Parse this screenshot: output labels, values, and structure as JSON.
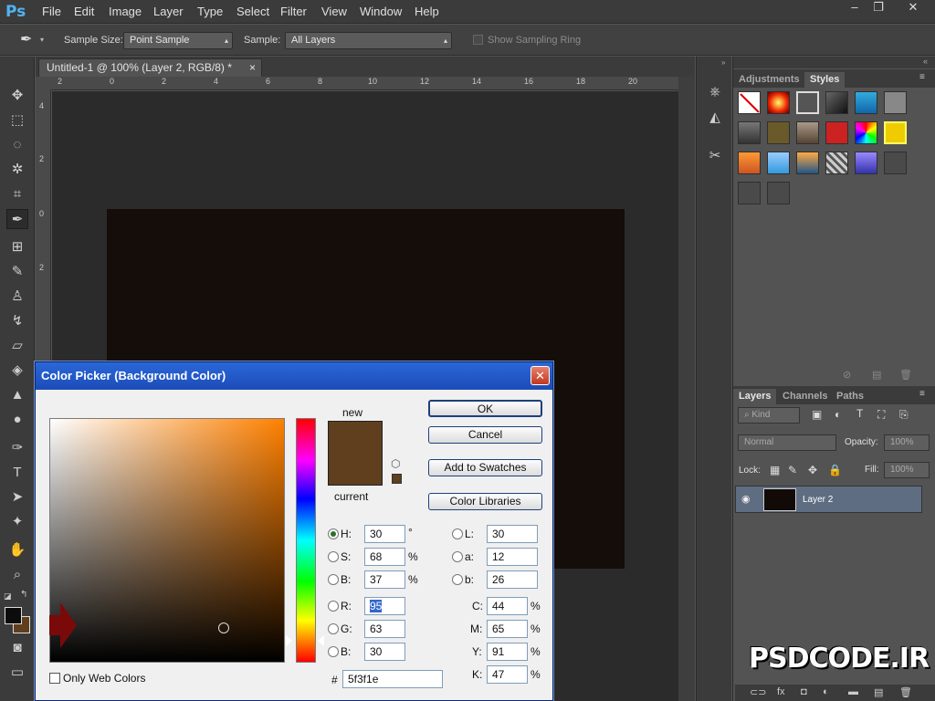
{
  "app": {
    "logo": "Ps"
  },
  "menu": [
    "File",
    "Edit",
    "Image",
    "Layer",
    "Type",
    "Select",
    "Filter",
    "View",
    "Window",
    "Help"
  ],
  "window_controls": {
    "minimize": "–",
    "restore": "❐",
    "close": "✕"
  },
  "options_bar": {
    "sample_size_label": "Sample Size:",
    "sample_size_value": "Point Sample",
    "sample_label": "Sample:",
    "sample_value": "All Layers",
    "show_ring_label": "Show Sampling Ring"
  },
  "document": {
    "tab_title": "Untitled-1 @ 100% (Layer 2, RGB/8) *",
    "tab_close": "×",
    "ruler_h": [
      "2",
      "0",
      "2",
      "4",
      "6",
      "8",
      "10",
      "12",
      "14",
      "16",
      "18",
      "20"
    ],
    "ruler_v": [
      "4",
      "2",
      "0",
      "2"
    ]
  },
  "panels": {
    "top_tabs": [
      "Adjustments",
      "Styles"
    ],
    "layers_tabs": [
      "Layers",
      "Channels",
      "Paths"
    ],
    "kind_label": "Kind",
    "blend_mode": "Normal",
    "opacity_label": "Opacity:",
    "opacity_value": "100%",
    "lock_label": "Lock:",
    "fill_label": "Fill:",
    "fill_value": "100%",
    "layer_name": "Layer 2"
  },
  "color_picker": {
    "title": "Color Picker (Background Color)",
    "close": "✕",
    "new_label": "new",
    "current_label": "current",
    "buttons": {
      "ok": "OK",
      "cancel": "Cancel",
      "add_swatches": "Add to Swatches",
      "libraries": "Color Libraries"
    },
    "hsb": {
      "h_label": "H:",
      "h": "30",
      "h_unit": "°",
      "s_label": "S:",
      "s": "68",
      "s_unit": "%",
      "b_label": "B:",
      "b": "37",
      "b_unit": "%"
    },
    "rgb": {
      "r_label": "R:",
      "r": "95",
      "g_label": "G:",
      "g": "63",
      "b_label": "B:",
      "b": "30"
    },
    "lab": {
      "l_label": "L:",
      "l": "30",
      "a_label": "a:",
      "a": "12",
      "b_label": "b:",
      "b": "26"
    },
    "cmyk": {
      "c_label": "C:",
      "c": "44",
      "m_label": "M:",
      "m": "65",
      "y_label": "Y:",
      "y": "91",
      "k_label": "K:",
      "k": "47",
      "unit": "%"
    },
    "hex_label": "#",
    "hex": "5f3f1e",
    "web_only_label": "Only Web Colors",
    "selected_color": "#5f3f1e"
  },
  "watermark": "PSDCODE.IR"
}
